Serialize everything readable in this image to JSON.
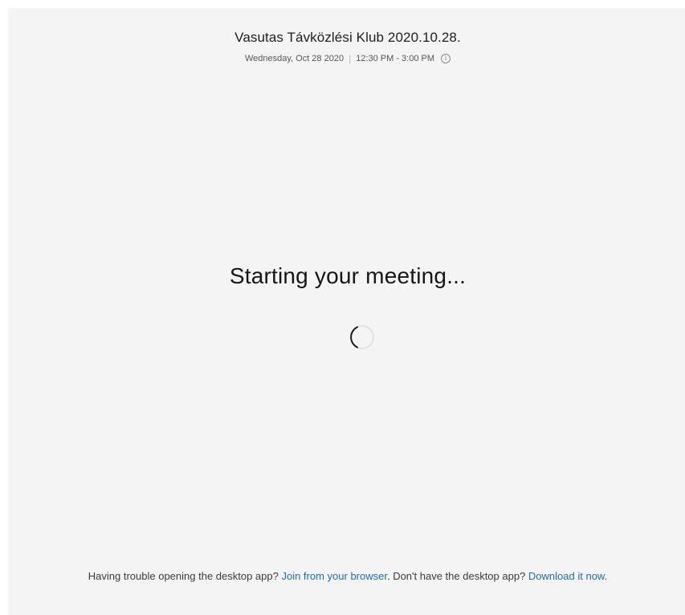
{
  "meeting": {
    "title": "Vasutas Távközlési Klub 2020.10.28.",
    "date": "Wednesday, Oct 28 2020",
    "separator": "|",
    "time": "12:30 PM - 3:00 PM",
    "info_glyph": "i"
  },
  "status": {
    "text": "Starting your meeting...",
    "spinner_icon": "loading-spinner-icon"
  },
  "footer": {
    "trouble_text": "Having trouble opening the desktop app? ",
    "join_link": "Join from your browser",
    "middle_text": ". Don't have the desktop app? ",
    "download_link": "Download it now",
    "end_text": "."
  },
  "colors": {
    "background": "#f4f4f4",
    "link": "#1f6cb0",
    "text": "#1e1e1e"
  }
}
